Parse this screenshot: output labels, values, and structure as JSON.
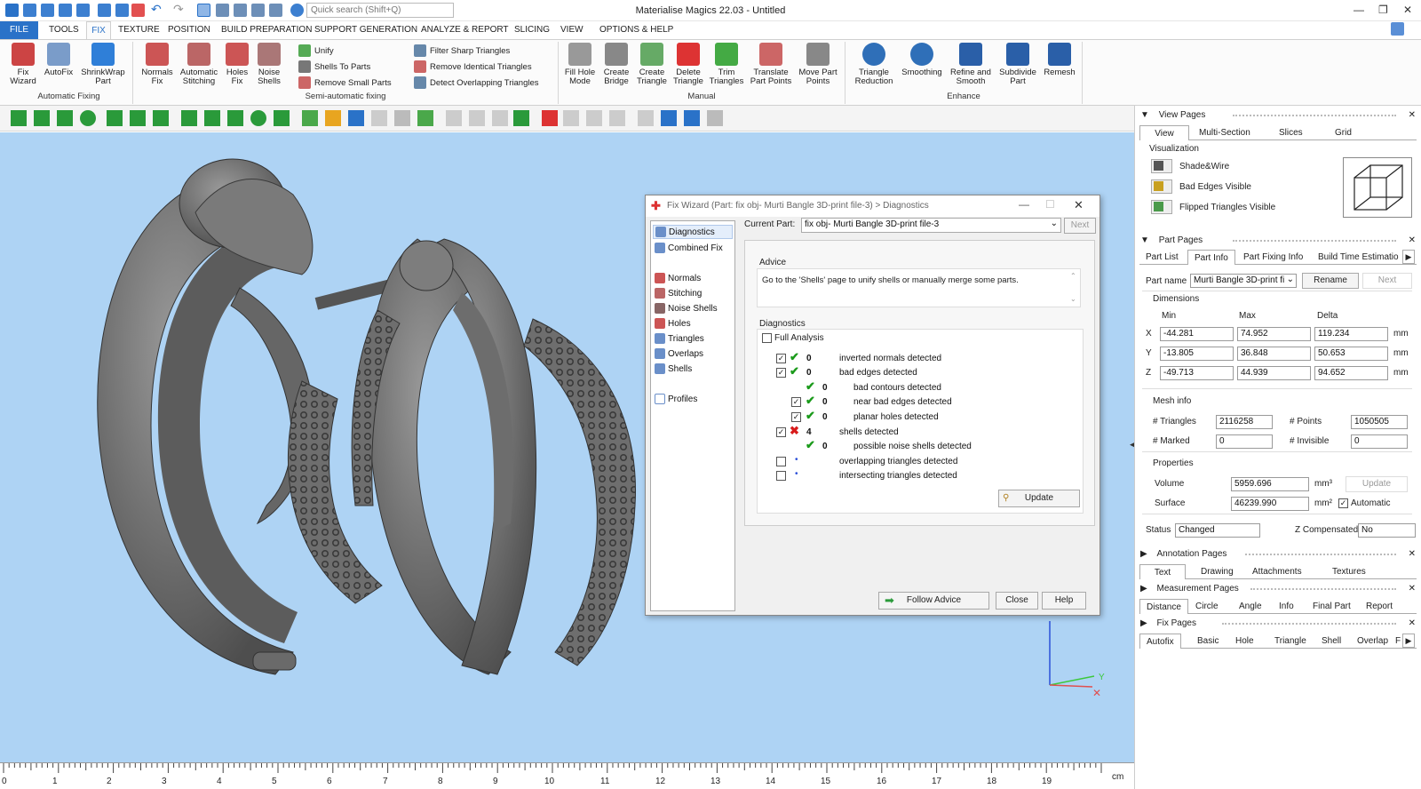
{
  "title_bar": {
    "title": "Materialise Magics 22.03 - Untitled",
    "search_placeholder": "Quick search (Shift+Q)"
  },
  "menus": [
    "FILE",
    "TOOLS",
    "FIX",
    "TEXTURE",
    "POSITION",
    "BUILD PREPARATION",
    "SUPPORT GENERATION",
    "ANALYZE & REPORT",
    "SLICING",
    "VIEW",
    "OPTIONS & HELP"
  ],
  "ribbon": {
    "automatic_fixing": {
      "group": "Automatic Fixing",
      "fix_wizard": "Fix Wizard",
      "autofix": "AutoFix",
      "shrinkwrap": "ShrinkWrap Part"
    },
    "semi_automatic": {
      "group": "Semi-automatic fixing",
      "normals_fix": "Normals Fix",
      "auto_stitching": "Automatic Stitching",
      "holes_fix": "Holes Fix",
      "noise_shells": "Noise Shells",
      "unify": "Unify",
      "shells_to_parts": "Shells To Parts",
      "remove_small_parts": "Remove Small Parts",
      "filter_sharp": "Filter Sharp Triangles",
      "remove_identical": "Remove Identical Triangles",
      "detect_overlapping": "Detect Overlapping Triangles"
    },
    "manual": {
      "group": "Manual",
      "fill_hole_mode": "Fill Hole Mode",
      "create_bridge": "Create Bridge",
      "create_triangle": "Create Triangle",
      "delete_triangle": "Delete Triangle",
      "trim_triangles": "Trim Triangles",
      "translate_part_points": "Translate Part Points",
      "move_part_points": "Move Part Points"
    },
    "enhance": {
      "group": "Enhance",
      "triangle_reduction": "Triangle Reduction",
      "smoothing": "Smoothing",
      "refine_smooth": "Refine and Smooth",
      "subdivide": "Subdivide Part",
      "remesh": "Remesh"
    }
  },
  "ruler": {
    "ticks": [
      "0",
      "1",
      "2",
      "3",
      "4",
      "5",
      "6",
      "7",
      "8",
      "9",
      "10",
      "11",
      "12",
      "13",
      "14",
      "15",
      "16",
      "17",
      "18",
      "19"
    ],
    "unit": "cm"
  },
  "axes": {
    "y": "Y"
  },
  "dialog": {
    "title": "Fix Wizard (Part: fix obj- Murti Bangle 3D-print file-3) > Diagnostics",
    "nav": [
      "Diagnostics",
      "Combined Fix",
      "Normals",
      "Stitching",
      "Noise Shells",
      "Holes",
      "Triangles",
      "Overlaps",
      "Shells",
      "Profiles"
    ],
    "current_part_label": "Current Part:",
    "current_part": "fix obj- Murti Bangle 3D-print file-3",
    "next": "Next",
    "advice_title": "Advice",
    "advice_text": "Go to the 'Shells' page to unify shells or manually merge some parts.",
    "diagnostics_title": "Diagnostics",
    "full_analysis": "Full Analysis",
    "rows": [
      {
        "count": "0",
        "text": "inverted normals detected"
      },
      {
        "count": "0",
        "text": "bad edges detected"
      },
      {
        "count": "0",
        "text": "bad contours detected"
      },
      {
        "count": "0",
        "text": "near bad edges detected"
      },
      {
        "count": "0",
        "text": "planar holes detected"
      },
      {
        "count": "4",
        "text": "shells detected"
      },
      {
        "count": "0",
        "text": "possible noise shells detected"
      },
      {
        "count": "",
        "text": "overlapping triangles detected"
      },
      {
        "count": "",
        "text": "intersecting triangles detected"
      }
    ],
    "update": "Update",
    "follow_advice": "Follow Advice",
    "close": "Close",
    "help": "Help"
  },
  "panel": {
    "view_pages": {
      "title": "View Pages",
      "tabs": [
        "View",
        "Multi-Section",
        "Slices",
        "Grid"
      ],
      "visualization": "Visualization",
      "items": [
        "Shade&Wire",
        "Bad Edges Visible",
        "Flipped Triangles Visible"
      ]
    },
    "part_pages": {
      "title": "Part Pages",
      "tabs": [
        "Part List",
        "Part Info",
        "Part Fixing Info",
        "Build Time Estimatio"
      ],
      "part_name_label": "Part name",
      "part_name": "Murti Bangle 3D-print fi",
      "rename": "Rename",
      "next": "Next",
      "dimensions": "Dimensions",
      "min": "Min",
      "max": "Max",
      "delta": "Delta",
      "x_label": "X",
      "y_label": "Y",
      "z_label": "Z",
      "x": [
        "-44.281",
        "74.952",
        "119.234"
      ],
      "y": [
        "-13.805",
        "36.848",
        "50.653"
      ],
      "z": [
        "-49.713",
        "44.939",
        "94.652"
      ],
      "mm": "mm",
      "mesh_info": "Mesh info",
      "triangles_label": "# Triangles",
      "triangles": "2116258",
      "points_label": "# Points",
      "points": "1050505",
      "marked_label": "# Marked",
      "marked": "0",
      "invisible_label": "# Invisible",
      "invisible": "0",
      "properties": "Properties",
      "volume_label": "Volume",
      "volume": "5959.696",
      "volume_unit": "mm³",
      "update": "Update",
      "surface_label": "Surface",
      "surface": "46239.990",
      "surface_unit": "mm²",
      "automatic": "Automatic",
      "status_label": "Status",
      "status": "Changed",
      "zcomp_label": "Z Compensated",
      "zcomp": "No"
    },
    "annotation_pages": {
      "title": "Annotation Pages",
      "tabs": [
        "Text",
        "Drawing",
        "Attachments",
        "Textures"
      ]
    },
    "measurement_pages": {
      "title": "Measurement Pages",
      "tabs": [
        "Distance",
        "Circle",
        "Angle",
        "Info",
        "Final Part",
        "Report"
      ]
    },
    "fix_pages": {
      "title": "Fix Pages",
      "tabs": [
        "Autofix",
        "Basic",
        "Hole",
        "Triangle",
        "Shell",
        "Overlap",
        "F"
      ]
    }
  }
}
